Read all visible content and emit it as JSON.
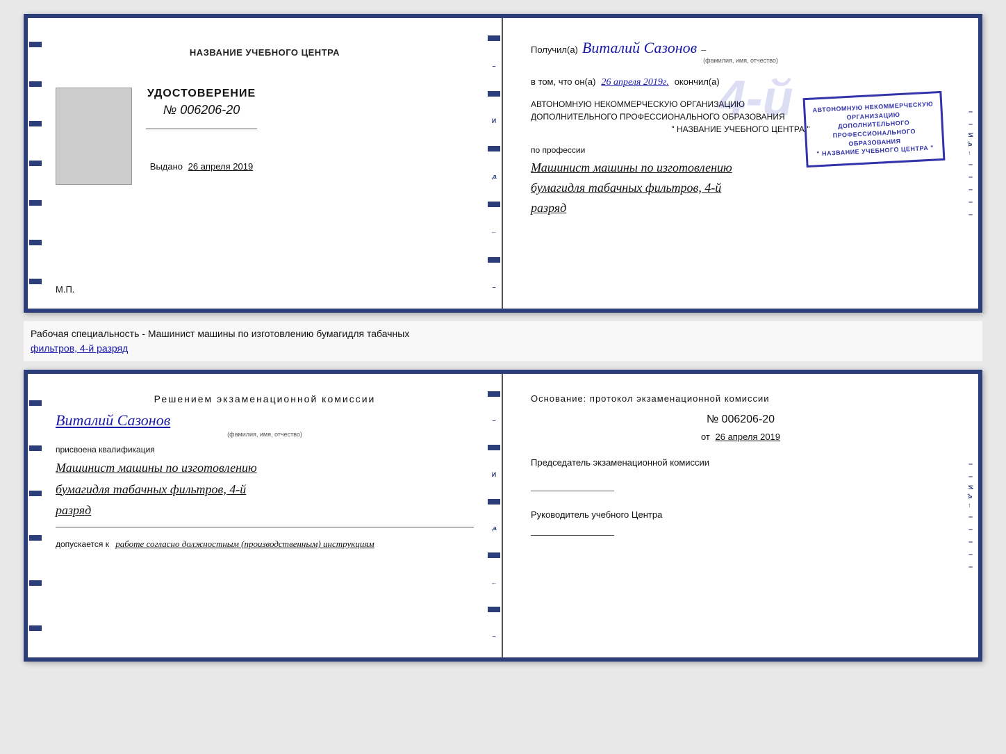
{
  "top_cert": {
    "left": {
      "center_title": "НАЗВАНИЕ УЧЕБНОГО ЦЕНТРА",
      "udostoverenie_label": "УДОСТОВЕРЕНИЕ",
      "number": "№ 006206-20",
      "vydano_label": "Выдано",
      "vydano_date": "26 апреля 2019",
      "mp_label": "М.П."
    },
    "right": {
      "poluchil_label": "Получил(а)",
      "recipient_name": "Виталий Сазонов",
      "fio_sublabel": "(фамилия, имя, отчество)",
      "vtom_label": "в том, что он(а)",
      "date_handwritten": "26 апреля 2019г.",
      "okonchil_label": "окончил(а)",
      "big_number": "4-й",
      "stamp_line1": "АВТОНОМНУЮ НЕКОММЕРЧЕСКУЮ ОРГАНИЗАЦИЮ",
      "stamp_line2": "ДОПОЛНИТЕЛЬНОГО ПРОФЕССИОНАЛЬНОГО ОБРАЗОВАНИЯ",
      "stamp_line3": "\" НАЗВАНИЕ УЧЕБНОГО ЦЕНТРА \"",
      "po_professii_label": "по профессии",
      "profession_line1": "Машинист машины по изготовлению",
      "profession_line2": "бумагидля табачных фильтров, 4-й",
      "profession_line3": "разряд"
    }
  },
  "middle_label": {
    "text_prefix": "Рабочая специальность - Машинист машины по изготовлению бумагидля табачных",
    "text_underlined": "фильтров, 4-й разряд"
  },
  "bottom_cert": {
    "left": {
      "resheniem_title": "Решением  экзаменационной  комиссии",
      "name": "Виталий Сазонов",
      "fio_sublabel": "(фамилия, имя, отчество)",
      "prisvoena_label": "присвоена квалификация",
      "qualification_line1": "Машинист машины по изготовлению",
      "qualification_line2": "бумагидля табачных фильтров, 4-й",
      "qualification_line3": "разряд",
      "dopuskaetsya_label": "допускается к",
      "dopuskaetsya_value": "работе согласно должностным (производственным) инструкциям"
    },
    "right": {
      "osnovanie_title": "Основание:  протокол  экзаменационной  комиссии",
      "protocol_number": "№  006206-20",
      "ot_label": "от",
      "ot_date": "26 апреля 2019",
      "chairman_label": "Председатель экзаменационной комиссии",
      "rukovoditel_label": "Руководитель учебного Центра"
    }
  }
}
